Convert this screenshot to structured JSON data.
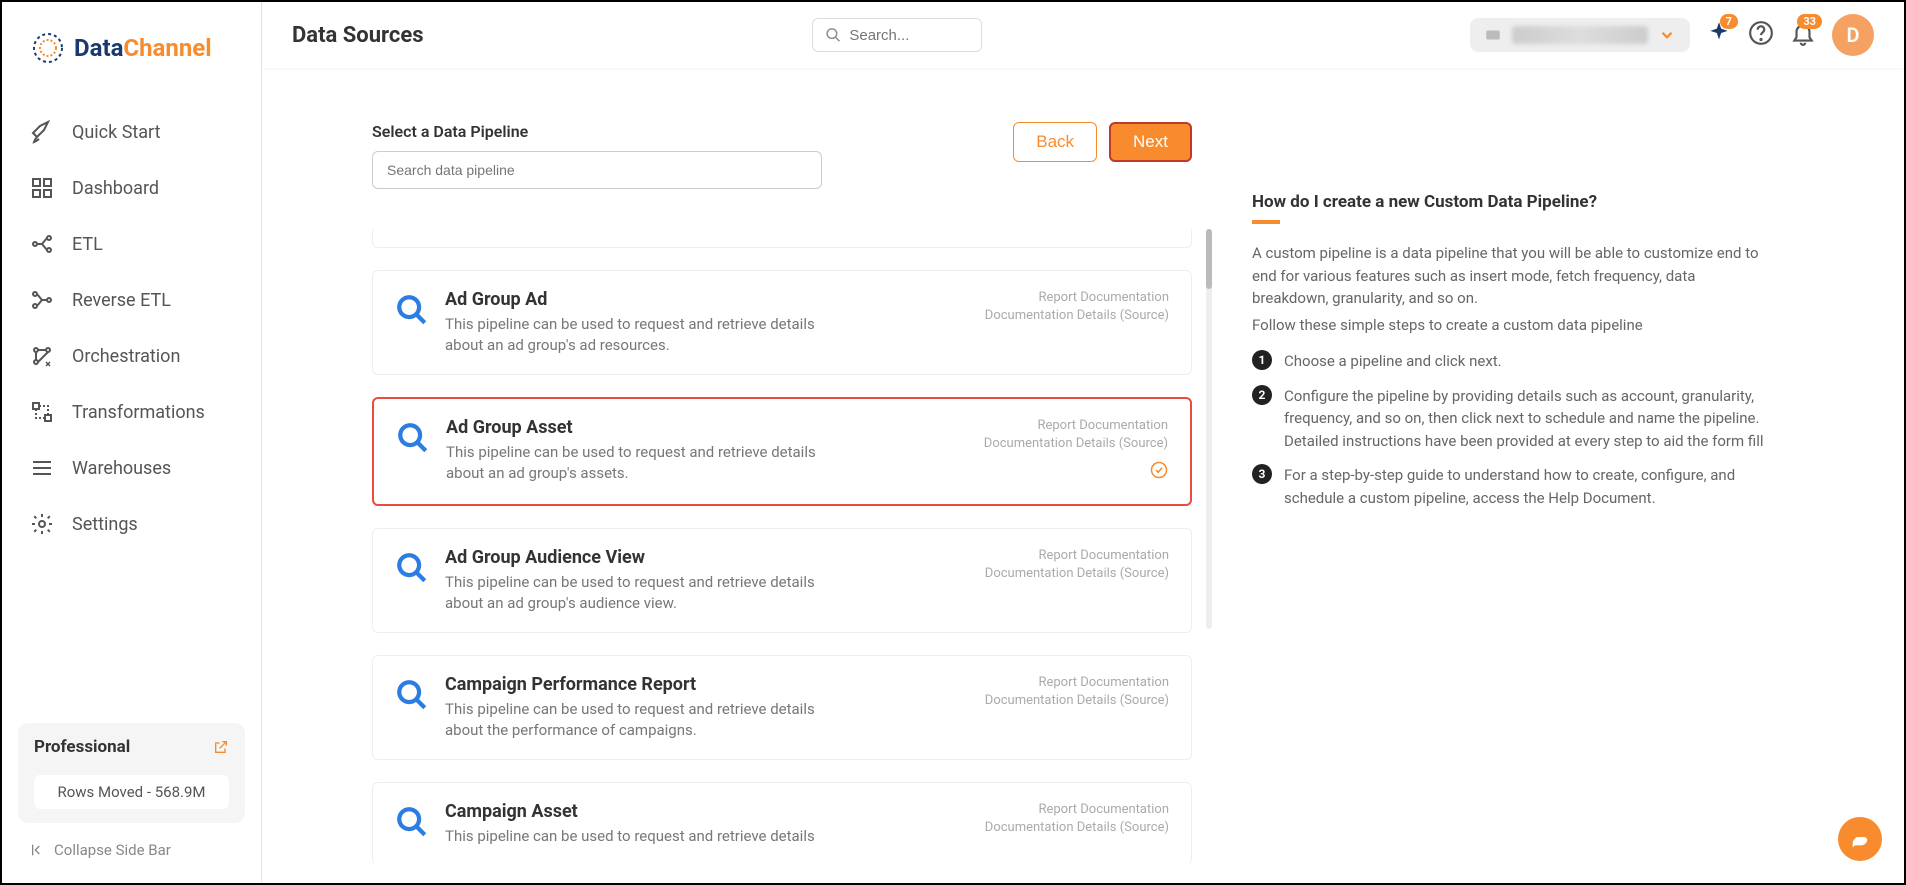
{
  "brand": {
    "part1": "Data",
    "part2": "Channel"
  },
  "nav": [
    {
      "label": "Quick Start"
    },
    {
      "label": "Dashboard"
    },
    {
      "label": "ETL"
    },
    {
      "label": "Reverse ETL"
    },
    {
      "label": "Orchestration"
    },
    {
      "label": "Transformations"
    },
    {
      "label": "Warehouses"
    },
    {
      "label": "Settings"
    }
  ],
  "plan": {
    "name": "Professional",
    "rows": "Rows Moved - 568.9M"
  },
  "collapse": "Collapse Side Bar",
  "header": {
    "title": "Data Sources",
    "search_placeholder": "Search..."
  },
  "topbar": {
    "sparkle_badge": "7",
    "bell_badge": "33",
    "avatar": "D"
  },
  "panel": {
    "section_title": "Select a Data Pipeline",
    "search_placeholder": "Search data pipeline",
    "back": "Back",
    "next": "Next"
  },
  "pipelines": [
    {
      "title": "Ad Group Ad",
      "desc": "This pipeline can be used to request and retrieve details about an ad group's ad resources.",
      "doc1": "Report Documentation",
      "doc2": "Documentation Details (Source)"
    },
    {
      "title": "Ad Group Asset",
      "desc": "This pipeline can be used to request and retrieve details about an ad group's assets.",
      "doc1": "Report Documentation",
      "doc2": "Documentation Details (Source)"
    },
    {
      "title": "Ad Group Audience View",
      "desc": "This pipeline can be used to request and retrieve details about an ad group's audience view.",
      "doc1": "Report Documentation",
      "doc2": "Documentation Details (Source)"
    },
    {
      "title": "Campaign Performance Report",
      "desc": "This pipeline can be used to request and retrieve details about the performance of campaigns.",
      "doc1": "Report Documentation",
      "doc2": "Documentation Details (Source)"
    },
    {
      "title": "Campaign Asset",
      "desc": "This pipeline can be used to request and retrieve details",
      "doc1": "Report Documentation",
      "doc2": "Documentation Details (Source)"
    }
  ],
  "info": {
    "title": "How do I create a new Custom Data Pipeline?",
    "p1": "A custom pipeline is a data pipeline that you will be able to customize end to end for various features such as insert mode, fetch frequency, data breakdown, granularity, and so on.",
    "p2": "Follow these simple steps to create a custom data pipeline",
    "steps": [
      "Choose a pipeline and click next.",
      "Configure the pipeline by providing details such as account, granularity, frequency, and so on, then click next to schedule and name the pipeline. Detailed instructions have been provided at every step to aid the form fill",
      "For a step-by-step guide to understand how to create, configure, and schedule a custom pipeline, access the Help Document."
    ]
  }
}
